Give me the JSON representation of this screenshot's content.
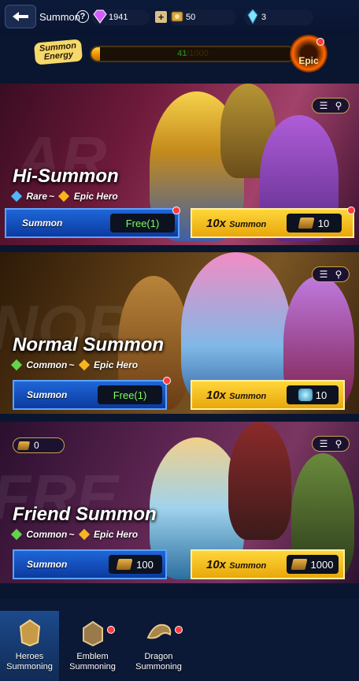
{
  "header": {
    "title": "Summon",
    "help_icon": "question-icon",
    "diamonds": "1941",
    "tickets": "50",
    "crystals": "3"
  },
  "energy": {
    "label": "Summon Energy",
    "current": "41",
    "max": "/1000",
    "fraction": 0.041,
    "badge": "Epic"
  },
  "banners": [
    {
      "bg_word": "AR",
      "title": "Hi-Summon",
      "rarity_from": "Rare",
      "sep": "~",
      "rarity_to": "Epic Hero",
      "single_label": "Summon",
      "single_cost": "Free(1)",
      "multi_prefix": "10x",
      "multi_label": "Summon",
      "multi_cost": "10"
    },
    {
      "bg_word": "NOR",
      "title": "Normal Summon",
      "rarity_from": "Common",
      "sep": "~",
      "rarity_to": "Epic Hero",
      "single_label": "Summon",
      "single_cost": "Free(1)",
      "multi_prefix": "10x",
      "multi_label": "Summon",
      "multi_cost": "10"
    },
    {
      "bg_word": "FRE",
      "title": "Friend Summon",
      "rarity_from": "Common",
      "sep": "~",
      "rarity_to": "Epic Hero",
      "points": "0",
      "single_label": "Summon",
      "single_cost": "100",
      "multi_prefix": "10x",
      "multi_label": "Summon",
      "multi_cost": "1000"
    }
  ],
  "nav": [
    {
      "label": "Heroes Summoning",
      "active": true
    },
    {
      "label": "Emblem Summoning"
    },
    {
      "label": "Dragon Summoning"
    }
  ],
  "colors": {
    "accent_gold": "#f5c21a",
    "accent_blue": "#1f66d8",
    "alert": "#ff3b3b"
  }
}
